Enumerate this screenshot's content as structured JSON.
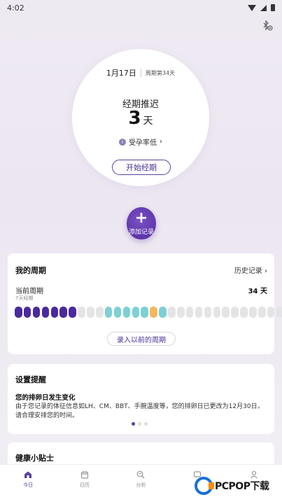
{
  "status_bar": {
    "time": "4:02"
  },
  "main": {
    "date": "1月17日",
    "cycle_day": "周期第34天",
    "status_title": "经期推迟",
    "days_count": "3",
    "days_unit": "天",
    "fertility_label": "受孕率低",
    "fertility_chevron": "›",
    "start_button": "开始经期"
  },
  "add_record": {
    "plus": "+",
    "label": "添加记录"
  },
  "cycle_card": {
    "title": "我的周期",
    "history_link": "历史记录 ›",
    "current_label": "当前周期",
    "current_sub": "7天经期",
    "current_days": "34 天",
    "past_button": "录入以前的周期",
    "dots": [
      "period",
      "period",
      "period",
      "period",
      "period",
      "period",
      "period",
      "normal",
      "normal",
      "normal",
      "fertile",
      "fertile",
      "fertile",
      "fertile",
      "fertile",
      "ovulation",
      "fertile",
      "normal",
      "normal",
      "normal",
      "normal",
      "normal",
      "normal",
      "normal",
      "normal",
      "normal",
      "normal",
      "normal",
      "normal",
      "normal"
    ]
  },
  "reminder_card": {
    "title": "设置提醒",
    "heading": "您的排卵日发生变化",
    "body": "由于您记录的体征信息如LH、CM、BBT、手腕温度等，您的排卵日已更改为12月30日，请合理安排您的时间。",
    "pages": 3,
    "active_page": 0
  },
  "tips_card": {
    "title": "健康小贴士"
  },
  "tabs": [
    {
      "label": "今日",
      "icon": "home-icon",
      "active": true
    },
    {
      "label": "日历",
      "icon": "calendar-icon",
      "active": false
    },
    {
      "label": "分析",
      "icon": "analysis-icon",
      "active": false
    },
    {
      "label": "",
      "icon": "message-icon",
      "active": false
    },
    {
      "label": "",
      "icon": "profile-icon",
      "active": false
    }
  ],
  "watermark": {
    "text": "PCPOP下载"
  },
  "colors": {
    "accent": "#5a3fa0",
    "period": "#4a2a9c",
    "fertile": "#7dd0d6",
    "ovulation": "#f2b95a",
    "normal": "#e4e4e6"
  }
}
